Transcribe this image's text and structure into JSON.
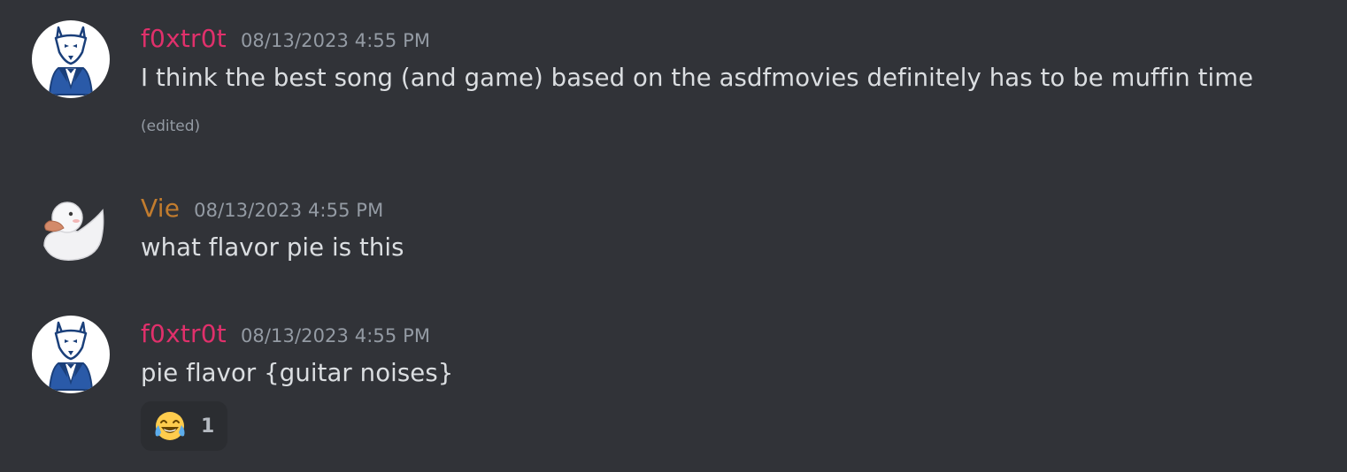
{
  "colors": {
    "background": "#313338",
    "text": "#dbdee1",
    "muted": "#949ba4",
    "reaction_bg": "#2b2d31"
  },
  "messages": [
    {
      "author": "f0xtr0t",
      "author_color": "#e0306b",
      "avatar_icon": "wolf-in-suit-icon",
      "timestamp": "08/13/2023 4:55 PM",
      "content": "I think the best song (and game) based on the asdfmovies definitely has to be muffin time",
      "edited_label": "(edited)"
    },
    {
      "author": "Vie",
      "author_color": "#c27c2e",
      "avatar_icon": "rubber-duck-icon",
      "timestamp": "08/13/2023 4:55 PM",
      "content": "what flavor pie is this"
    },
    {
      "author": "f0xtr0t",
      "author_color": "#e0306b",
      "avatar_icon": "wolf-in-suit-icon",
      "timestamp": "08/13/2023 4:55 PM",
      "content": "pie flavor {guitar noises}",
      "reaction": {
        "emoji_icon": "face-with-tears-of-joy-icon",
        "count": "1"
      }
    }
  ]
}
